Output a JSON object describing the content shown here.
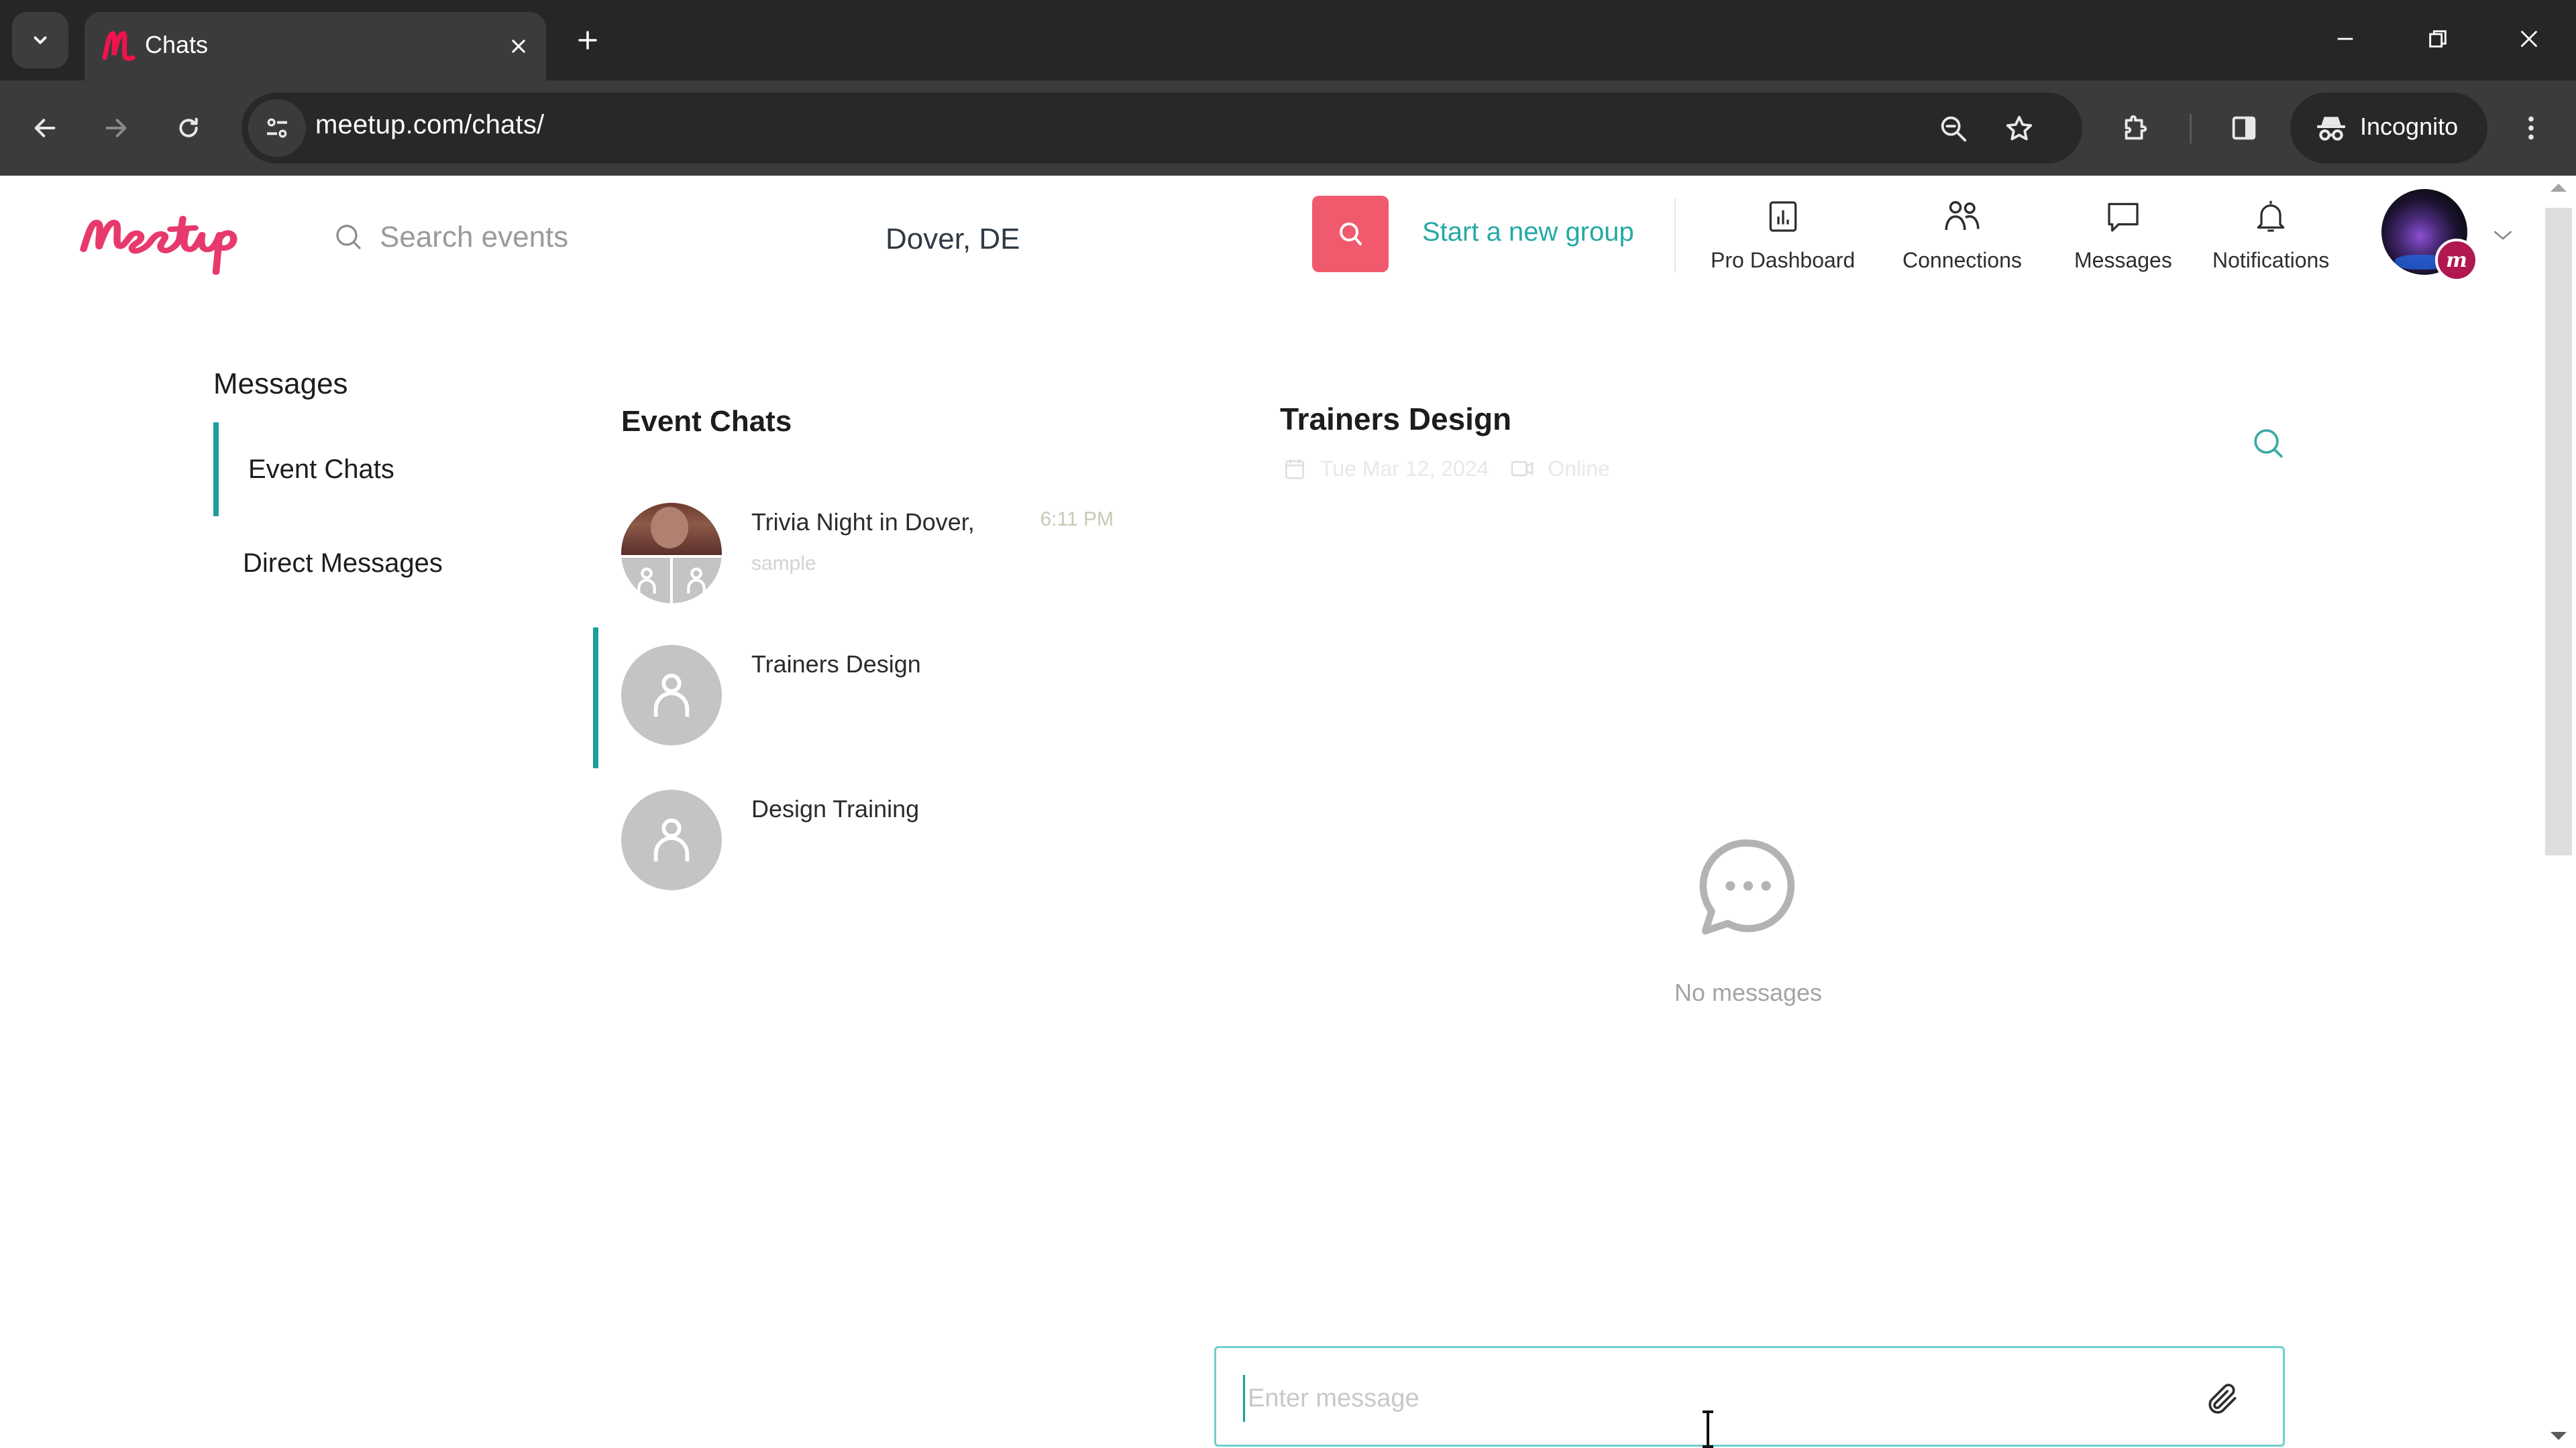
{
  "browser": {
    "tab_title": "Chats",
    "url": "meetup.com/chats/",
    "incognito_label": "Incognito",
    "icons": {
      "tab_search": "chevron-down-icon",
      "tab_close": "close-icon",
      "new_tab": "plus-icon",
      "minimize": "minimize-icon",
      "restore": "restore-icon",
      "close_window": "close-icon",
      "back": "arrow-left-icon",
      "forward": "arrow-right-icon",
      "reload": "reload-icon",
      "site_info": "tune-icon",
      "zoom": "zoom-out-icon",
      "bookmark": "star-icon",
      "extensions": "puzzle-icon",
      "side_panel": "side-panel-icon",
      "incognito": "incognito-icon",
      "menu": "kebab-menu-icon"
    }
  },
  "header": {
    "logo_alt": "Meetup",
    "search_placeholder": "Search events",
    "location": "Dover, DE",
    "start_group_label": "Start a new group",
    "nav": [
      {
        "label": "Pro Dashboard",
        "icon": "bar-chart-icon"
      },
      {
        "label": "Connections",
        "icon": "people-icon"
      },
      {
        "label": "Messages",
        "icon": "speech-bubble-icon"
      },
      {
        "label": "Notifications",
        "icon": "bell-icon"
      }
    ],
    "colors": {
      "brand": "#f05a6c",
      "accent": "#1d9f9c",
      "link": "#25a9a4",
      "badge": "#b0184f"
    }
  },
  "sidebar": {
    "title": "Messages",
    "items": [
      {
        "label": "Event Chats",
        "active": true
      },
      {
        "label": "Direct Messages",
        "active": false
      }
    ]
  },
  "chat_list": {
    "title": "Event Chats",
    "chats": [
      {
        "name": "Trivia Night in Dover,",
        "snippet": "sample",
        "time": "6:11 PM",
        "active": false,
        "avatar": "group"
      },
      {
        "name": "Trainers Design",
        "snippet": "",
        "time": "",
        "active": true,
        "avatar": "person"
      },
      {
        "name": "Design Training",
        "snippet": "",
        "time": "",
        "active": false,
        "avatar": "person"
      }
    ]
  },
  "conversation": {
    "title": "Trainers Design",
    "date": "Tue Mar 12, 2024",
    "location": "Online",
    "empty_label": "No messages",
    "composer_placeholder": "Enter message",
    "composer_value": ""
  }
}
